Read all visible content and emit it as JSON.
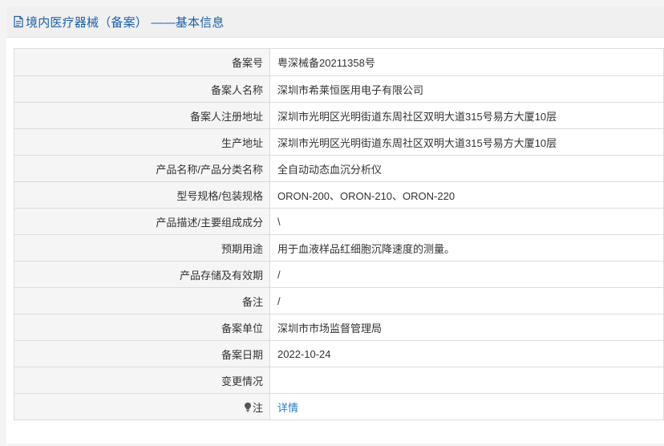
{
  "header": {
    "title": "境内医疗器械（备案） ——基本信息",
    "icon": "document-icon"
  },
  "rows": [
    {
      "label": "备案号",
      "value": "粤深械备20211358号"
    },
    {
      "label": "备案人名称",
      "value": "深圳市希莱恒医用电子有限公司"
    },
    {
      "label": "备案人注册地址",
      "value": "深圳市光明区光明街道东周社区双明大道315号易方大厦10层"
    },
    {
      "label": "生产地址",
      "value": "深圳市光明区光明街道东周社区双明大道315号易方大厦10层"
    },
    {
      "label": "产品名称/产品分类名称",
      "value": "全自动动态血沉分析仪"
    },
    {
      "label": "型号规格/包装规格",
      "value": "ORON-200、ORON-210、ORON-220"
    },
    {
      "label": "产品描述/主要组成成分",
      "value": "\\"
    },
    {
      "label": "预期用途",
      "value": "用于血液样品红细胞沉降速度的测量。"
    },
    {
      "label": "产品存储及有效期",
      "value": "/"
    },
    {
      "label": "备注",
      "value": "/"
    },
    {
      "label": "备案单位",
      "value": "深圳市市场监督管理局"
    },
    {
      "label": "备案日期",
      "value": "2022-10-24"
    },
    {
      "label": "变更情况",
      "value": ""
    }
  ],
  "note": {
    "label": "注",
    "icon": "lightbulb-icon",
    "link_text": "详情"
  },
  "colors": {
    "title": "#1d5fa8",
    "link": "#2a79c9",
    "label_bg": "#f5f5f5",
    "border": "#dcdcdc"
  }
}
